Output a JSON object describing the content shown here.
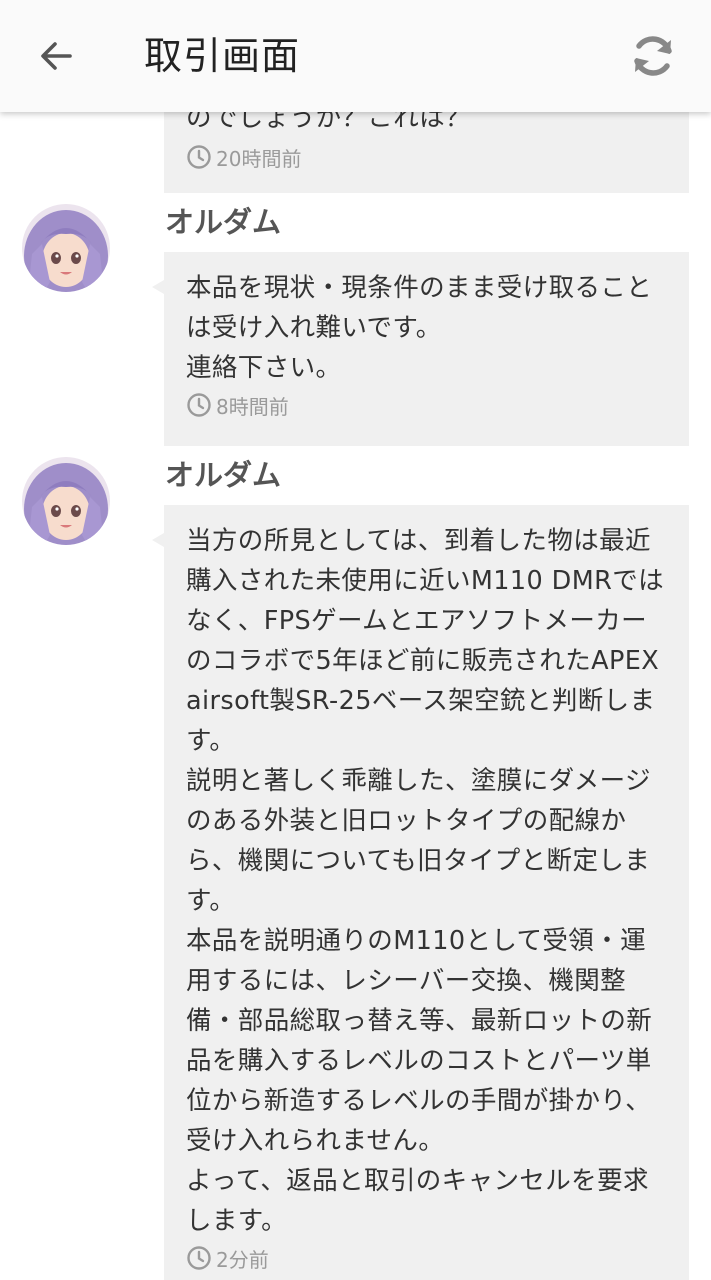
{
  "header": {
    "title": "取引画面",
    "back_icon": "arrow-left-icon",
    "refresh_icon": "refresh-icon"
  },
  "messages": [
    {
      "text": "のでしょうか？これは？",
      "time": "20時間前"
    },
    {
      "sender": "オルダム",
      "text": "本品を現状・現条件のまま受け取ることは受け入れ難いです。\n連絡下さい。",
      "time": "8時間前"
    },
    {
      "sender": "オルダム",
      "text": "当方の所見としては、到着した物は最近購入された未使用に近いM110 DMRではなく、FPSゲームとエアソフトメーカーのコラボで5年ほど前に販売されたAPEX airsoft製SR-25ベース架空銃と判断します。\n説明と著しく乖離した、塗膜にダメージのある外装と旧ロットタイプの配線から、機関についても旧タイプと断定します。\n本品を説明通りのM110として受領・運用するには、レシーバー交換、機関整備・部品総取っ替え等、最新ロットの新品を購入するレベルのコストとパーツ単位から新造するレベルの手間が掛かり、受け入れられません。\nよって、返品と取引のキャンセルを要求します。",
      "time": "2分前"
    }
  ],
  "colors": {
    "bubble_bg": "#f0f0f0",
    "header_bg": "#fafafa",
    "timestamp": "#9a9a9a",
    "sender": "#555555"
  }
}
